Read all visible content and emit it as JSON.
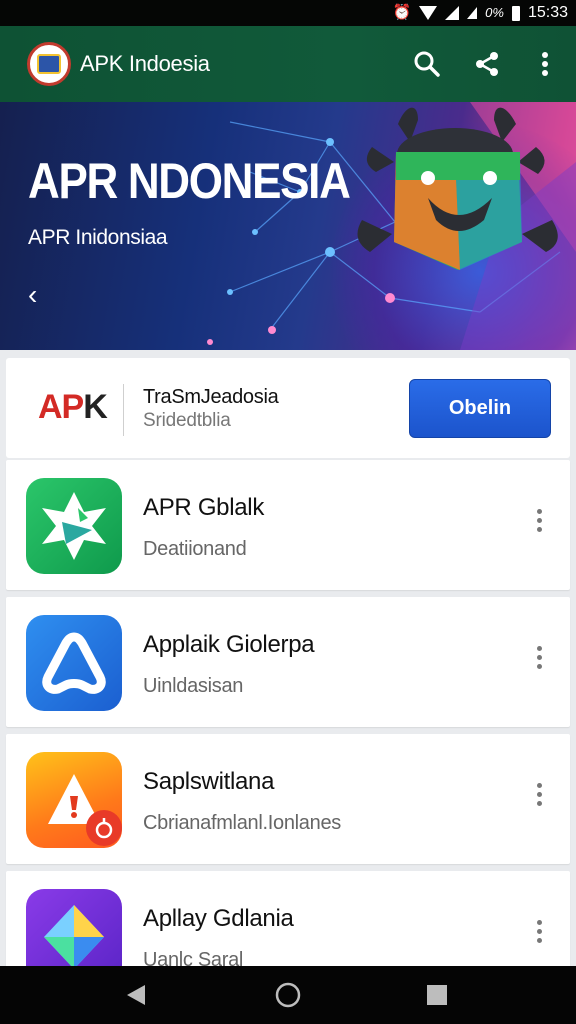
{
  "status_bar": {
    "battery_text": "0%",
    "time": "15:33",
    "icons": [
      "alarm-icon",
      "wifi-icon",
      "signal-icon",
      "signal-icon",
      "battery-icon"
    ]
  },
  "app_bar": {
    "title": "APK Indoesia",
    "actions": [
      "search-icon",
      "share-icon",
      "more-vert-icon"
    ],
    "color": "#115a3a"
  },
  "hero": {
    "title": "APR NDONESIA",
    "subtitle": "APR Inidonsiaa",
    "nav_prev": "‹"
  },
  "promo": {
    "brand_a": "AP",
    "brand_k": "K",
    "title": "TraSmJeadosia",
    "subtitle": "Sridedtblia",
    "button_label": "Obelin",
    "button_color": "#1f5fd9"
  },
  "apps": [
    {
      "name": "APR Gblalk",
      "desc": "Deatiionand",
      "icon": "green-app-icon"
    },
    {
      "name": "Applaik Giolerpa",
      "desc": "Uinldasisan",
      "icon": "blue-app-icon"
    },
    {
      "name": "Saplswitlana",
      "desc": "Cbrianafmlanl.Ionlanes",
      "icon": "orange-app-icon"
    },
    {
      "name": "Apllay Gdlania",
      "desc": "Uanlc Saral",
      "icon": "purple-app-icon"
    }
  ],
  "nav_bar": {
    "buttons": [
      "back-icon",
      "home-icon",
      "recents-icon"
    ]
  }
}
